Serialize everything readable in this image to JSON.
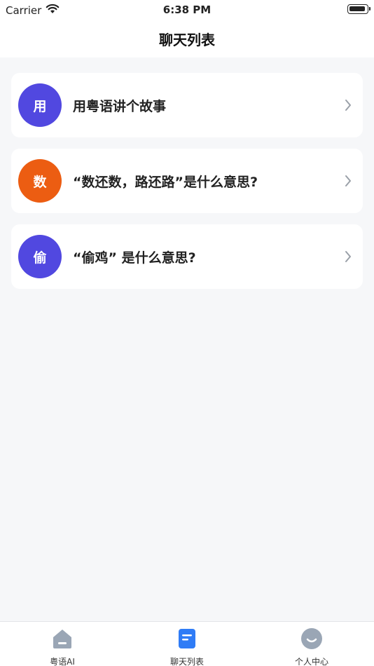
{
  "status_bar": {
    "carrier": "Carrier",
    "time": "6:38 PM"
  },
  "header": {
    "title": "聊天列表"
  },
  "chats": [
    {
      "avatar_text": "用",
      "avatar_color": "#5148e0",
      "title": "用粤语讲个故事"
    },
    {
      "avatar_text": "数",
      "avatar_color": "#ec5d12",
      "title": "“数还数，路还路”是什么意思?"
    },
    {
      "avatar_text": "偷",
      "avatar_color": "#5148e0",
      "title": "“偷鸡” 是什么意思?"
    }
  ],
  "tab_bar": {
    "tabs": [
      {
        "label": "粤语AI",
        "icon": "home-icon",
        "active": false
      },
      {
        "label": "聊天列表",
        "icon": "chat-list-icon",
        "active": true
      },
      {
        "label": "个人中心",
        "icon": "profile-icon",
        "active": false
      }
    ]
  },
  "colors": {
    "active_tab": "#2f7cf6",
    "inactive_tab": "#9aa6b5"
  }
}
